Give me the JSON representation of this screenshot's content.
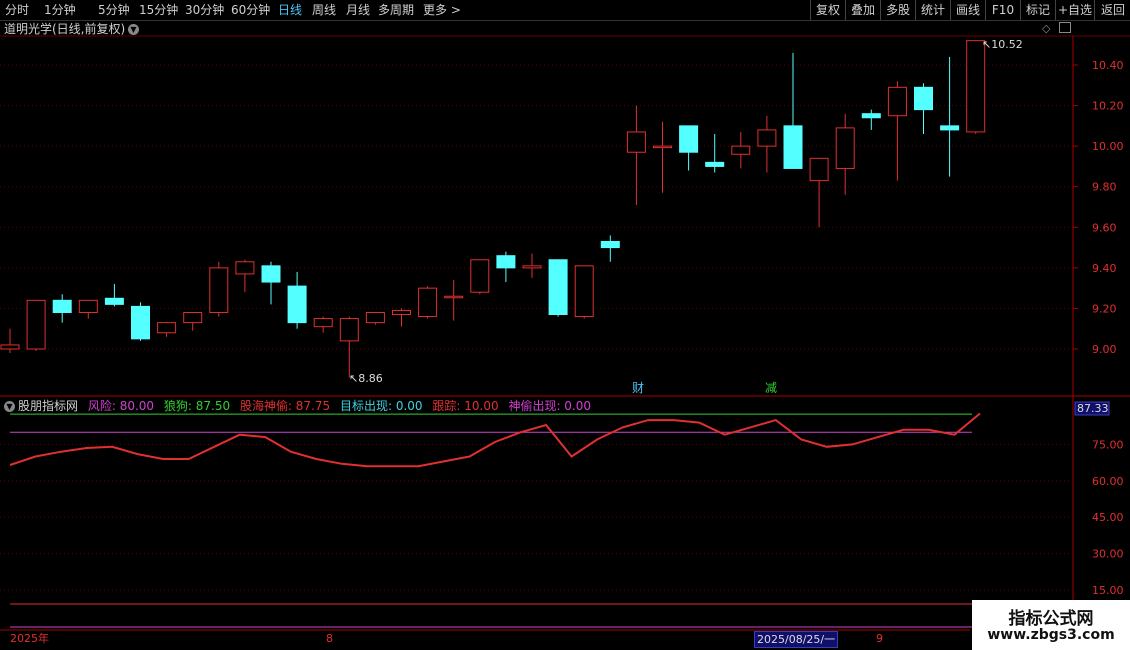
{
  "toolbar": {
    "left": [
      "分时",
      "1分钟",
      "5分钟",
      "15分钟",
      "30分钟",
      "60分钟",
      "日线",
      "周线",
      "月线",
      "多周期",
      "更多"
    ],
    "active": "日线",
    "right": [
      "复权",
      "叠加",
      "多股",
      "统计",
      "画线",
      "F10",
      "标记",
      "+自选",
      "返回"
    ]
  },
  "title": "道明光学(日线,前复权)",
  "price_axis": [
    "10.40",
    "10.20",
    "10.00",
    "9.80",
    "9.60",
    "9.40",
    "9.20",
    "9.00"
  ],
  "indicator_axis": [
    "75.00",
    "60.00",
    "45.00",
    "30.00",
    "15.00"
  ],
  "indicator_current": "87.33",
  "high_label": "10.52",
  "low_label": "8.86",
  "markers": [
    "财",
    "减"
  ],
  "indicator": {
    "name": "股朋指标网",
    "items": [
      {
        "label": "风险: 80.00",
        "color": "#d040d0"
      },
      {
        "label": "狼狗: 87.50",
        "color": "#30d030"
      },
      {
        "label": "股海神偷: 87.75",
        "color": "#e03030"
      },
      {
        "label": "目标出现: 0.00",
        "color": "#40d0e0"
      },
      {
        "label": "跟踪: 10.00",
        "color": "#e03030"
      },
      {
        "label": "神偷出现: 0.00",
        "color": "#d040d0"
      }
    ]
  },
  "dates": {
    "year": "2025年",
    "aug": "8",
    "selected": "2025/08/25/一",
    "sep": "9"
  },
  "watermark": {
    "line1": "指标公式网",
    "line2": "www.zbgs3.com"
  },
  "colors": {
    "up": "#e03030",
    "down": "#54ffff",
    "risk": "#d040d0",
    "wolf": "#30d030"
  },
  "candles": [
    [
      9.0,
      9.02,
      9.1,
      8.98
    ],
    [
      9.0,
      9.24,
      9.24,
      8.99
    ],
    [
      9.24,
      9.18,
      9.27,
      9.13
    ],
    [
      9.18,
      9.24,
      9.24,
      9.15
    ],
    [
      9.25,
      9.22,
      9.32,
      9.21
    ],
    [
      9.21,
      9.05,
      9.23,
      9.04
    ],
    [
      9.08,
      9.13,
      9.13,
      9.06
    ],
    [
      9.13,
      9.18,
      9.18,
      9.09
    ],
    [
      9.18,
      9.4,
      9.43,
      9.16
    ],
    [
      9.37,
      9.43,
      9.44,
      9.28
    ],
    [
      9.41,
      9.33,
      9.43,
      9.22
    ],
    [
      9.31,
      9.13,
      9.38,
      9.1
    ],
    [
      9.11,
      9.15,
      9.16,
      9.08
    ],
    [
      9.04,
      9.15,
      9.16,
      8.86
    ],
    [
      9.13,
      9.18,
      9.18,
      9.12
    ],
    [
      9.17,
      9.19,
      9.2,
      9.11
    ],
    [
      9.16,
      9.3,
      9.31,
      9.15
    ],
    [
      9.26,
      9.26,
      9.34,
      9.14
    ],
    [
      9.28,
      9.44,
      9.44,
      9.27
    ],
    [
      9.46,
      9.4,
      9.48,
      9.33
    ],
    [
      9.4,
      9.41,
      9.47,
      9.35
    ],
    [
      9.44,
      9.17,
      9.44,
      9.16
    ],
    [
      9.16,
      9.41,
      9.41,
      9.15
    ],
    [
      9.53,
      9.5,
      9.56,
      9.43
    ],
    [
      9.97,
      10.07,
      10.2,
      9.71
    ],
    [
      10.0,
      10.0,
      10.12,
      9.77
    ],
    [
      10.1,
      9.97,
      10.1,
      9.88
    ],
    [
      9.92,
      9.9,
      10.06,
      9.87
    ],
    [
      9.96,
      10.0,
      10.07,
      9.89
    ],
    [
      10.0,
      10.08,
      10.15,
      9.87
    ],
    [
      10.1,
      9.89,
      10.46,
      9.89
    ],
    [
      9.83,
      9.94,
      9.94,
      9.6
    ],
    [
      9.89,
      10.09,
      10.16,
      9.76
    ],
    [
      10.16,
      10.14,
      10.18,
      10.08
    ],
    [
      10.15,
      10.29,
      10.32,
      9.83
    ],
    [
      10.29,
      10.18,
      10.31,
      10.06
    ],
    [
      10.1,
      10.08,
      10.44,
      9.85
    ],
    [
      10.07,
      10.52,
      10.52,
      10.06
    ]
  ],
  "indicator_values": [
    66.5,
    70,
    72,
    73.5,
    74,
    71,
    69,
    69,
    74,
    79,
    78,
    72,
    69,
    67,
    66,
    66,
    66,
    68,
    70,
    76,
    80,
    83,
    70,
    77,
    82,
    85,
    85,
    84,
    79,
    82,
    85,
    77,
    74,
    75,
    78,
    81,
    81,
    79,
    87.75
  ]
}
